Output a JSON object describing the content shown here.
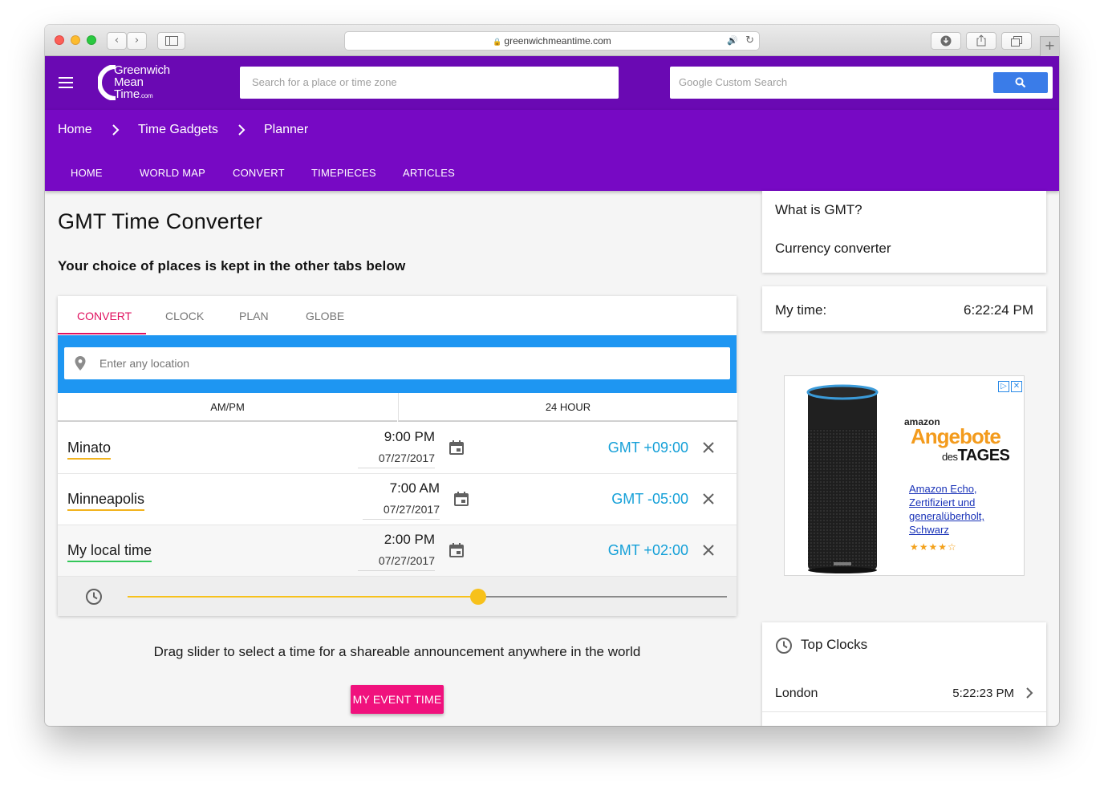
{
  "browser": {
    "url": "greenwichmeantime.com",
    "back_glyph": "‹",
    "forward_glyph": "›",
    "new_tab_glyph": "+"
  },
  "site": {
    "logo_lines": [
      "Greenwich",
      "Mean",
      "Time"
    ],
    "logo_suffix": ".com",
    "search_placeholder": "Search for a place or time zone",
    "google_search_placeholder": "Google Custom Search"
  },
  "breadcrumb": [
    "Home",
    "Time Gadgets",
    "Planner"
  ],
  "nav": [
    "HOME",
    "WORLD MAP",
    "CONVERT",
    "TIMEPIECES",
    "ARTICLES"
  ],
  "main": {
    "title": "GMT Time Converter",
    "subtitle": "Your choice of places is kept in the other tabs below",
    "tabs": [
      {
        "label": "CONVERT",
        "active": true
      },
      {
        "label": "CLOCK",
        "active": false
      },
      {
        "label": "PLAN",
        "active": false
      },
      {
        "label": "GLOBE",
        "active": false
      }
    ],
    "location_placeholder": "Enter any location",
    "format_options": [
      "AM/PM",
      "24 HOUR"
    ],
    "rows": [
      {
        "place": "Minato",
        "time": "9:00 PM",
        "date": "07/27/2017",
        "offset": "GMT +09:00",
        "underline": "#f2b31e"
      },
      {
        "place": "Minneapolis",
        "time": "7:00 AM",
        "date": "07/27/2017",
        "offset": "GMT -05:00",
        "underline": "#f2b31e"
      },
      {
        "place": "My local time",
        "time": "2:00 PM",
        "date": "07/27/2017",
        "offset": "GMT +02:00",
        "underline": "#34c759"
      }
    ],
    "slider_fraction": 0.585,
    "drag_hint": "Drag slider to select a time for a shareable announcement anywhere in the world",
    "event_button": "MY EVENT TIME"
  },
  "sidebar": {
    "links": [
      "What is GMT?",
      "Currency converter"
    ],
    "my_time_label": "My time:",
    "my_time_value": "6:22:24 PM",
    "ad": {
      "brand": "amazon",
      "headline": "Angebote",
      "sub_prefix": "des",
      "sub_main": "TAGES",
      "description": "Amazon Echo, Zertifiziert und generalüberholt, Schwarz",
      "stars": "★★★★☆",
      "speaker_label": "amazon"
    },
    "top_clocks_title": "Top Clocks",
    "top_clocks": [
      {
        "city": "London",
        "time": "5:22:23 PM"
      }
    ]
  },
  "colors": {
    "header_purple": "#6a09b3",
    "nav_purple": "#7709c4",
    "accent_pink": "#e0115f",
    "location_blue": "#1e96f2",
    "offset_blue": "#15a0d8",
    "slider_yellow": "#f7c11b",
    "event_pink": "#f0117d"
  },
  "icons": [
    "menu-icon",
    "logo-icon",
    "search-icon",
    "chevron-right-icon",
    "location-pin-icon",
    "calendar-icon",
    "close-icon",
    "clock-icon",
    "lock-icon",
    "reload-icon"
  ]
}
